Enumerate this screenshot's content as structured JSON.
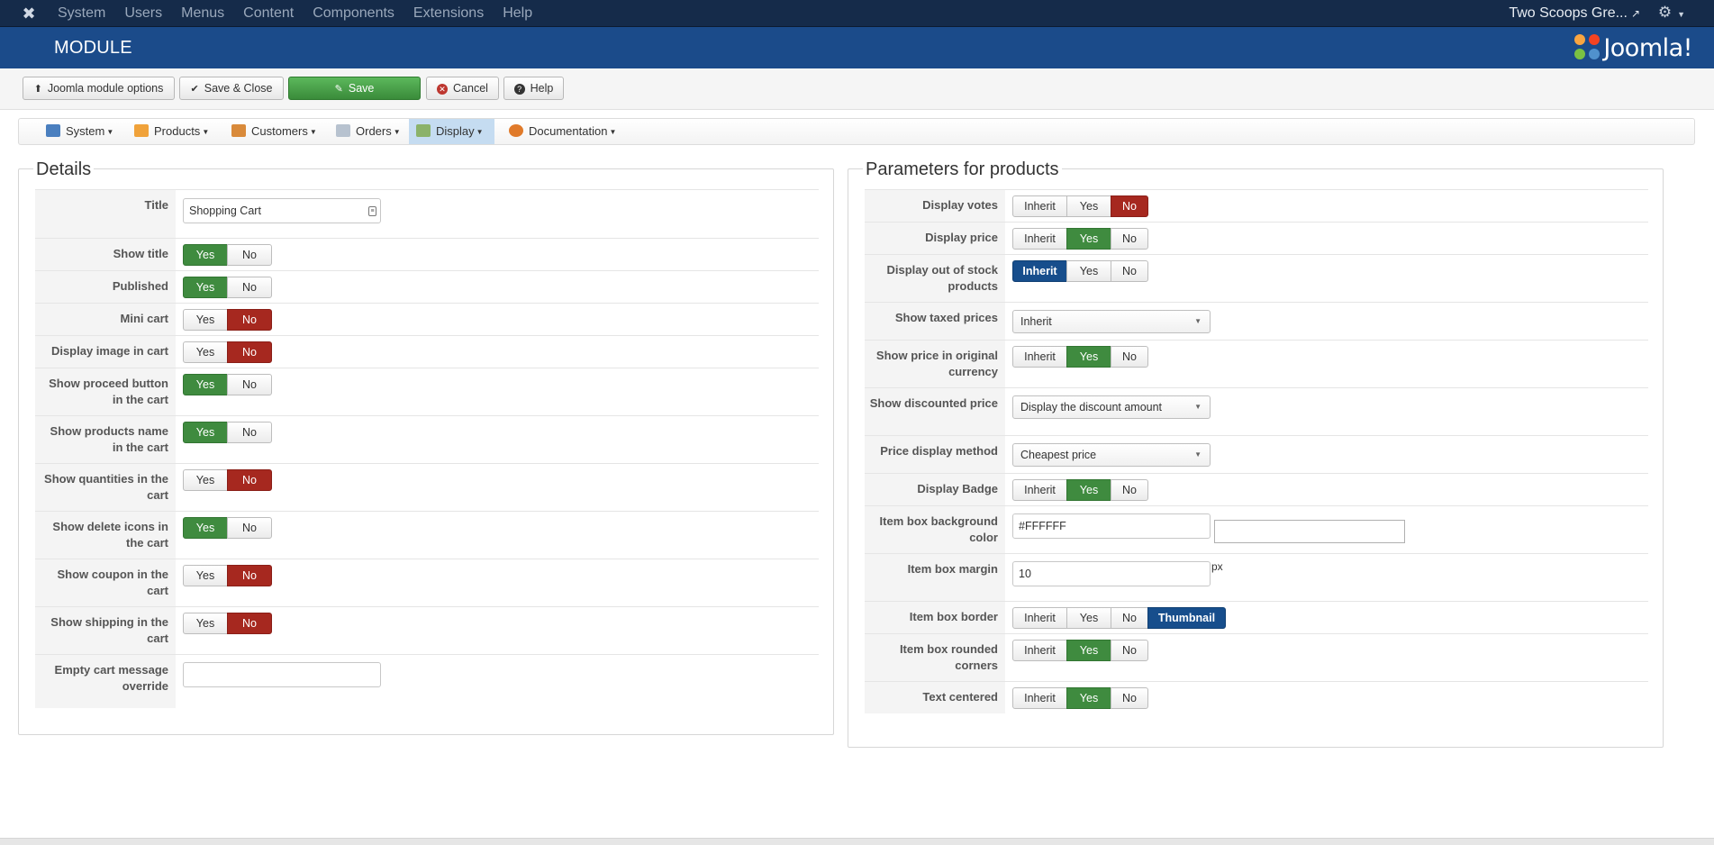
{
  "topbar": {
    "menu": [
      "System",
      "Users",
      "Menus",
      "Content",
      "Components",
      "Extensions",
      "Help"
    ],
    "site_name": "Two Scoops Gre..."
  },
  "header": {
    "title": "MODULE",
    "brand": "Joomla!"
  },
  "toolbar": {
    "module_options": "Joomla module options",
    "save_close": "Save & Close",
    "save": "Save",
    "cancel": "Cancel",
    "help": "Help"
  },
  "compnav": [
    "System",
    "Products",
    "Customers",
    "Orders",
    "Display",
    "Documentation"
  ],
  "details": {
    "legend": "Details",
    "title_label": "Title",
    "title_value": "Shopping Cart",
    "rows": [
      {
        "label": "Show title",
        "options": [
          "Yes",
          "No"
        ],
        "selected": "Yes"
      },
      {
        "label": "Published",
        "options": [
          "Yes",
          "No"
        ],
        "selected": "Yes"
      },
      {
        "label": "Mini cart",
        "options": [
          "Yes",
          "No"
        ],
        "selected": "No"
      },
      {
        "label": "Display image in cart",
        "options": [
          "Yes",
          "No"
        ],
        "selected": "No"
      },
      {
        "label": "Show proceed button in the cart",
        "options": [
          "Yes",
          "No"
        ],
        "selected": "Yes"
      },
      {
        "label": "Show products name in the cart",
        "options": [
          "Yes",
          "No"
        ],
        "selected": "Yes"
      },
      {
        "label": "Show quantities in the cart",
        "options": [
          "Yes",
          "No"
        ],
        "selected": "No"
      },
      {
        "label": "Show delete icons in the cart",
        "options": [
          "Yes",
          "No"
        ],
        "selected": "Yes"
      },
      {
        "label": "Show coupon in the cart",
        "options": [
          "Yes",
          "No"
        ],
        "selected": "No"
      },
      {
        "label": "Show shipping in the cart",
        "options": [
          "Yes",
          "No"
        ],
        "selected": "No"
      }
    ],
    "empty_cart_label": "Empty cart message override",
    "empty_cart_value": ""
  },
  "params": {
    "legend": "Parameters for products",
    "display_votes": {
      "label": "Display votes",
      "options": [
        "Inherit",
        "Yes",
        "No"
      ],
      "selected": "No"
    },
    "display_price": {
      "label": "Display price",
      "options": [
        "Inherit",
        "Yes",
        "No"
      ],
      "selected": "Yes"
    },
    "display_out_of_stock": {
      "label": "Display out of stock products",
      "options": [
        "Inherit",
        "Yes",
        "No"
      ],
      "selected": "Inherit"
    },
    "show_taxed_prices": {
      "label": "Show taxed prices",
      "value": "Inherit"
    },
    "show_price_original": {
      "label": "Show price in original currency",
      "options": [
        "Inherit",
        "Yes",
        "No"
      ],
      "selected": "Yes"
    },
    "show_discounted": {
      "label": "Show discounted price",
      "value": "Display the discount amount"
    },
    "price_display_method": {
      "label": "Price display method",
      "value": "Cheapest price"
    },
    "display_badge": {
      "label": "Display Badge",
      "options": [
        "Inherit",
        "Yes",
        "No"
      ],
      "selected": "Yes"
    },
    "item_box_bg": {
      "label": "Item box background color",
      "value": "#FFFFFF"
    },
    "item_box_margin": {
      "label": "Item box margin",
      "value": "10",
      "unit": "px"
    },
    "item_box_border": {
      "label": "Item box border",
      "options": [
        "Inherit",
        "Yes",
        "No",
        "Thumbnail"
      ],
      "selected": "Thumbnail"
    },
    "item_box_rounded": {
      "label": "Item box rounded corners",
      "options": [
        "Inherit",
        "Yes",
        "No"
      ],
      "selected": "Yes"
    },
    "text_centered": {
      "label": "Text centered",
      "options": [
        "Inherit",
        "Yes",
        "No"
      ],
      "selected": "Yes"
    }
  },
  "colors": {
    "navbar": "#152b4a",
    "header": "#1b4b8a",
    "yes_green": "#3f8b3f",
    "no_red": "#a6281f",
    "selected_blue": "#174e8c"
  }
}
